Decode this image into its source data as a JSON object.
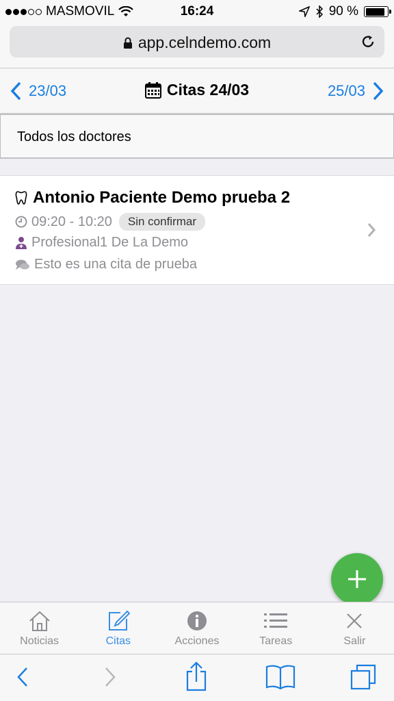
{
  "status": {
    "carrier": "MASMOVIL",
    "time": "16:24",
    "battery": "90 %",
    "battery_level": 0.9
  },
  "browser": {
    "url": "app.celndemo.com",
    "icons": [
      "lock-icon",
      "reload-icon",
      "back-icon",
      "forward-icon",
      "share-icon",
      "bookmarks-icon",
      "tabs-icon"
    ]
  },
  "datenav": {
    "prev_label": "23/03",
    "title": "Citas 24/03",
    "next_label": "25/03"
  },
  "filter": {
    "selected": "Todos los doctores"
  },
  "appointment": {
    "patient": "Antonio Paciente Demo prueba 2",
    "time": "09:20 - 10:20",
    "status": "Sin confirmar",
    "professional": "Profesional1 De La Demo",
    "note": "Esto es una cita de prueba"
  },
  "tabs": [
    {
      "label": "Noticias",
      "icon": "home-icon"
    },
    {
      "label": "Citas",
      "icon": "edit-icon"
    },
    {
      "label": "Acciones",
      "icon": "info-icon"
    },
    {
      "label": "Tareas",
      "icon": "list-icon"
    },
    {
      "label": "Salir",
      "icon": "close-icon"
    }
  ],
  "colors": {
    "accent": "#1a7ee0",
    "active_tab": "#3a8ee6",
    "fab": "#4cb64c",
    "professional_icon": "#7b4a8c"
  }
}
